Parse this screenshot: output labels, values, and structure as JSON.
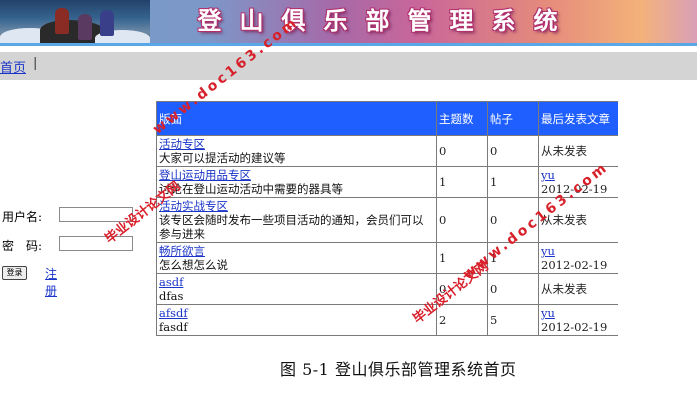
{
  "banner": {
    "title_chars": [
      "登",
      "山",
      "俱",
      "乐",
      "部",
      "管",
      "理",
      "系",
      "统"
    ]
  },
  "nav": {
    "home_label": "首页",
    "separator": "|"
  },
  "login": {
    "username_label": "用户名:",
    "password_label": "密　码:",
    "login_button": "登录",
    "register_label": "注册"
  },
  "table": {
    "headers": [
      "版面",
      "主题数",
      "帖子",
      "最后发表文章"
    ],
    "rows": [
      {
        "name": "活动专区",
        "desc": "大家可以提活动的建议等",
        "topics": "0",
        "posts": "0",
        "last_user": "",
        "last_text": "从未发表"
      },
      {
        "name": "登山运动用品专区",
        "desc": "讨论在登山运动活动中需要的器具等",
        "topics": "1",
        "posts": "1",
        "last_user": "yu",
        "last_text": "2012-02-19"
      },
      {
        "name": "活动实战专区",
        "desc": "该专区会随时发布一些项目活动的通知，会员们可以参与进来",
        "topics": "0",
        "posts": "0",
        "last_user": "",
        "last_text": "从未发表"
      },
      {
        "name": "畅所欲言",
        "desc": "怎么想怎么说",
        "topics": "1",
        "posts": "1",
        "last_user": "yu",
        "last_text": "2012-02-19"
      },
      {
        "name": "asdf",
        "desc": "dfas",
        "topics": "0",
        "posts": "0",
        "last_user": "",
        "last_text": "从未发表"
      },
      {
        "name": "afsdf",
        "desc": "fasdf",
        "topics": "2",
        "posts": "5",
        "last_user": "yu",
        "last_text": "2012-02-19"
      }
    ]
  },
  "caption": "图 5-1  登山俱乐部管理系统首页",
  "watermarks": {
    "site_text": "毕业设计论文网",
    "url_text": "www.doc163.com"
  },
  "colors": {
    "header_blue": "#1f5fff",
    "link_blue": "#1a35c8",
    "watermark_red": "#d8202a",
    "nav_gray": "#d4d4d4"
  }
}
